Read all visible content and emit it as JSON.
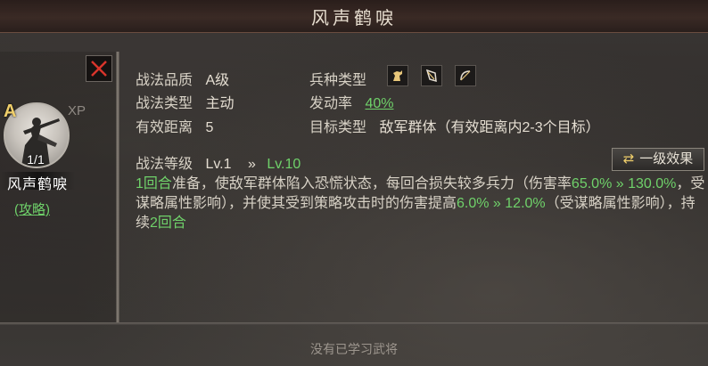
{
  "title": "风声鹤唳",
  "card": {
    "grade": "A",
    "xp": "XP",
    "count": "1/1",
    "name": "风声鹤唳",
    "strategy_link": "(攻略)"
  },
  "info": {
    "quality_label": "战法品质",
    "quality_value": "A级",
    "type_label": "战法类型",
    "type_value": "主动",
    "range_label": "有效距离",
    "range_value": "5",
    "troop_label": "兵种类型",
    "trigger_label": "发动率",
    "trigger_value": "40%",
    "target_label": "目标类型",
    "target_value": "敌军群体（有效距离内2-3个目标）",
    "level_label": "战法等级",
    "level_from": "Lv.1",
    "arrow": "»",
    "level_to": "Lv.10"
  },
  "effect_button": {
    "icon": "⇄",
    "label": "一级效果"
  },
  "desc": {
    "p1": "1回合",
    "p2": "准备，使敌军群体陷入恐慌状态，每回合损失较多兵力（伤害率",
    "p3": "65.0% » 130.0%",
    "p4": "，受谋略属性影响），并使其受到策略攻击时的伤害提高",
    "p5": "6.0% » 12.0%",
    "p6": "（受谋略属性影响），持续",
    "p7": "2回合"
  },
  "footer": "没有已学习武将",
  "colors": {
    "accent_green": "#6fd16a",
    "grade_gold": "#f0cf6b",
    "close_red": "#d8342b"
  },
  "icons": [
    "close-icon",
    "cavalry-icon",
    "shield-icon",
    "bow-icon",
    "swap-icon"
  ]
}
